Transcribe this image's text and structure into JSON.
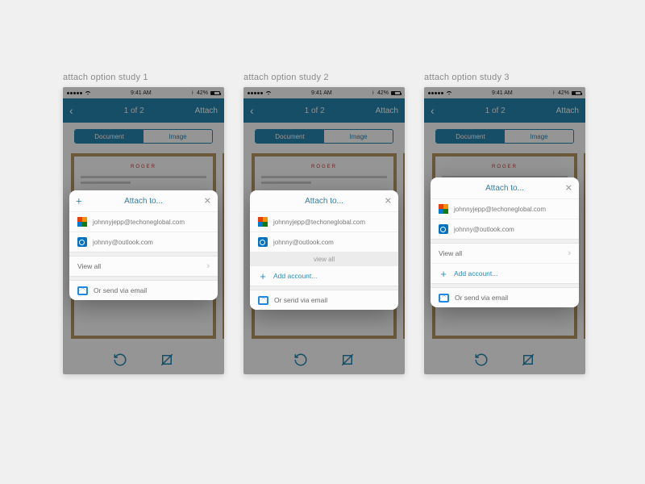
{
  "labels": {
    "study1": "attach option study 1",
    "study2": "attach option study 2",
    "study3": "attach option study 3"
  },
  "statusbar": {
    "time": "9:41 AM",
    "batt": "42%",
    "bt": "*"
  },
  "navbar": {
    "title": "1 of 2",
    "attach": "Attach"
  },
  "seg": {
    "document": "Document",
    "image": "Image"
  },
  "sheet": {
    "title": "Attach to...",
    "acct1": "johnnyjepp@techoneglobal.com",
    "acct2": "johnny@outlook.com",
    "viewall": "View all",
    "viewall_mini": "view all",
    "addaccount": "Add account...",
    "sendemail": "Or send via email"
  },
  "doc": {
    "title": "ROGER"
  }
}
